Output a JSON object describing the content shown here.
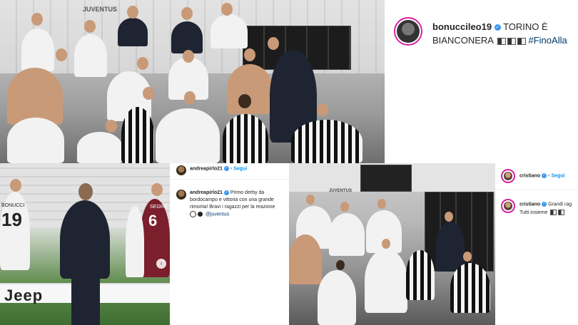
{
  "post_top": {
    "username": "bonuccileo19",
    "caption_line1": "TORINO È",
    "caption_line2": "BIANCONERA",
    "hashtag": "#FinoAlla"
  },
  "post_andrea": {
    "header_username": "andreapirlo21",
    "follow_label": "Segui",
    "username": "andreapirlo21",
    "caption": "Primo derby da bordocampo e vittoria con una grande rimonta! Bravi i ragazzi per la reazione",
    "mention": "@juventus",
    "jersey_19": "19",
    "jersey_6": "6",
    "shirt_name_1": "BONUCCI",
    "shirt_name_2": "SEGRE",
    "board_text": "Jeep"
  },
  "post_cristiano": {
    "header_username": "cristiano",
    "follow_label": "Segui",
    "username": "cristiano",
    "caption_line1": "Grandi rag",
    "caption_line2": "Tutti insieme"
  },
  "photo_top": {
    "wall_text": "JUVENTUS"
  },
  "photo_br": {
    "wall_text": "JUVENTUS"
  }
}
